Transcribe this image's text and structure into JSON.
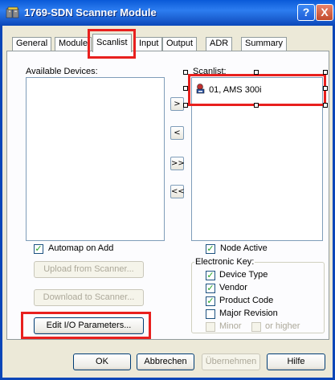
{
  "window": {
    "title": "1769-SDN Scanner Module",
    "help_label": "?",
    "close_label": "X"
  },
  "tabs": [
    {
      "label": "General"
    },
    {
      "label": "Module"
    },
    {
      "label": "Scanlist"
    },
    {
      "label": "Input"
    },
    {
      "label": "Output"
    },
    {
      "label": "ADR"
    },
    {
      "label": "Summary"
    }
  ],
  "active_tab": "Scanlist",
  "available_devices": {
    "label": "Available Devices:",
    "items": []
  },
  "scanlist": {
    "label": "Scanlist:",
    "items": [
      {
        "label": "01, AMS 300i",
        "icon": "device-icon"
      }
    ]
  },
  "move_buttons": {
    "add": ">",
    "remove": "<",
    "add_all": ">>",
    "remove_all": "<<"
  },
  "automap": {
    "label": "Automap on Add",
    "checked": true
  },
  "node_active": {
    "label": "Node Active",
    "checked": true
  },
  "electronic_key": {
    "label": "Electronic Key:",
    "device_type": {
      "label": "Device Type",
      "checked": true
    },
    "vendor": {
      "label": "Vendor",
      "checked": true
    },
    "product_code": {
      "label": "Product Code",
      "checked": true
    },
    "major_revision": {
      "label": "Major Revision",
      "checked": false
    },
    "minor": {
      "label": "Minor",
      "checked": false
    },
    "or_higher": {
      "label": "or higher",
      "checked": false
    }
  },
  "actions": {
    "upload": "Upload from Scanner...",
    "download": "Download to Scanner...",
    "edit_io": "Edit I/O Parameters..."
  },
  "footer": {
    "ok": "OK",
    "cancel": "Abbrechen",
    "apply": "Übernehmen",
    "help": "Hilfe"
  },
  "colors": {
    "highlight": "#e8201e",
    "titlebar": "#0a5ad8"
  }
}
